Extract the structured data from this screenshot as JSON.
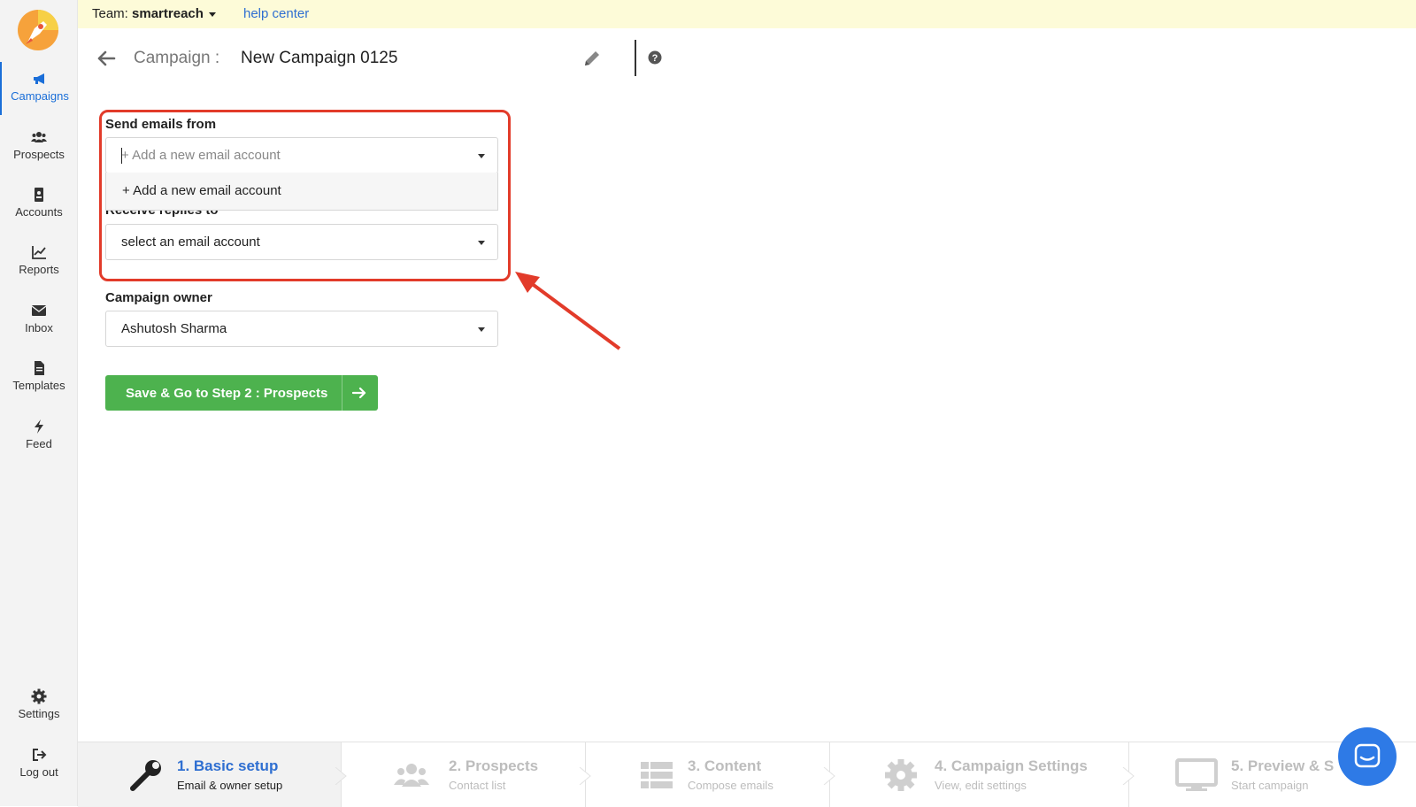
{
  "app": {
    "brand_colors": {
      "accent": "#1a6ed8",
      "primary_button": "#4db24e",
      "highlight": "#e23b2a"
    }
  },
  "topbar": {
    "team_label": "Team:",
    "team_name": "smartreach",
    "help_label": "help center"
  },
  "sidebar": {
    "items": [
      {
        "label": "Campaigns",
        "icon": "megaphone-icon",
        "active": true
      },
      {
        "label": "Prospects",
        "icon": "users-icon"
      },
      {
        "label": "Accounts",
        "icon": "contact-card-icon"
      },
      {
        "label": "Reports",
        "icon": "line-chart-icon"
      },
      {
        "label": "Inbox",
        "icon": "envelope-icon"
      },
      {
        "label": "Templates",
        "icon": "document-icon"
      },
      {
        "label": "Feed",
        "icon": "bolt-icon"
      }
    ],
    "bottom": [
      {
        "label": "Settings",
        "icon": "gear-icon"
      },
      {
        "label": "Log out",
        "icon": "logout-icon"
      }
    ]
  },
  "header": {
    "crumb": "Campaign :",
    "title": "New Campaign 0125"
  },
  "form": {
    "send_from": {
      "label": "Send emails from",
      "placeholder": "+ Add a new email account",
      "dropdown_option": "+ Add a new email account"
    },
    "reply_to": {
      "label": "Receive replies to",
      "value": "select an email account"
    },
    "owner": {
      "label": "Campaign owner",
      "value": "Ashutosh Sharma"
    },
    "save_button": "Save & Go to Step 2 : Prospects"
  },
  "steps": [
    {
      "title": "1. Basic setup",
      "subtitle": "Email & owner setup",
      "icon": "wrench-icon",
      "active": true
    },
    {
      "title": "2. Prospects",
      "subtitle": "Contact list",
      "icon": "users-icon"
    },
    {
      "title": "3. Content",
      "subtitle": "Compose emails",
      "icon": "list-icon"
    },
    {
      "title": "4. Campaign Settings",
      "subtitle": "View, edit settings",
      "icon": "gear-icon"
    },
    {
      "title": "5. Preview & S",
      "subtitle": "Start campaign",
      "icon": "monitor-icon"
    }
  ]
}
